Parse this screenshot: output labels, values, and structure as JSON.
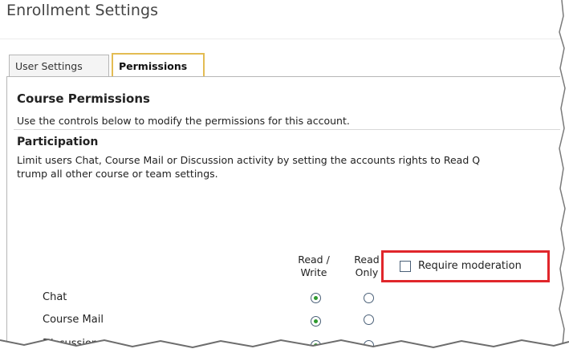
{
  "page": {
    "title": "Enrollment Settings"
  },
  "tabs": [
    {
      "label": "User Settings",
      "active": false
    },
    {
      "label": "Permissions",
      "active": true
    }
  ],
  "course_permissions": {
    "heading": "Course Permissions",
    "description": "Use the controls below to modify the permissions for this account."
  },
  "participation": {
    "heading": "Participation",
    "description_line1": "Limit users Chat, Course Mail or Discussion activity by setting the accounts rights to Read Q",
    "description_line2": "trump all other course or team settings."
  },
  "columns": {
    "read_write": {
      "line1": "Read /",
      "line2": "Write"
    },
    "read_only": {
      "line1": "Read",
      "line2": "Only"
    }
  },
  "rows": [
    {
      "label": "Chat",
      "selected": "read_write"
    },
    {
      "label": "Course Mail",
      "selected": "read_write"
    },
    {
      "label": "Discussion",
      "selected": "read_write"
    }
  ],
  "moderation": {
    "label": "Require moderation",
    "checked": false
  },
  "colors": {
    "active_tab_border": "#e3bc53",
    "highlight_box": "#e0262b",
    "radio_selected": "#2f9a2f"
  }
}
